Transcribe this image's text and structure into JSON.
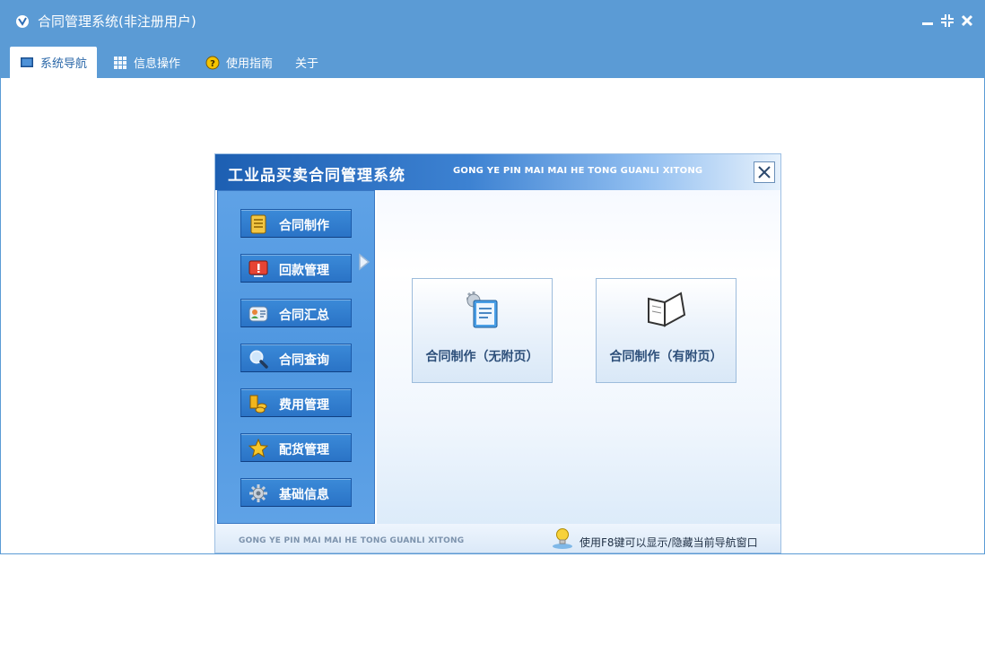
{
  "window": {
    "title": "合同管理系统(非注册用户)"
  },
  "tabs": [
    {
      "label": "系统导航",
      "icon": "monitor-icon",
      "active": true
    },
    {
      "label": "信息操作",
      "icon": "grid-icon",
      "active": false
    },
    {
      "label": "使用指南",
      "icon": "help-icon",
      "active": false
    },
    {
      "label": "关于",
      "icon": "",
      "active": false
    }
  ],
  "panel": {
    "title": "工业品买卖合同管理系统",
    "subtitle": "GONG YE PIN MAI MAI HE TONG GUANLI XITONG",
    "nav": [
      {
        "label": "合同制作",
        "icon": "ledger-icon",
        "selected": true
      },
      {
        "label": "回款管理",
        "icon": "alert-monitor-icon"
      },
      {
        "label": "合同汇总",
        "icon": "contacts-icon"
      },
      {
        "label": "合同查询",
        "icon": "magnifier-icon"
      },
      {
        "label": "费用管理",
        "icon": "coins-icon"
      },
      {
        "label": "配货管理",
        "icon": "star-icon"
      },
      {
        "label": "基础信息",
        "icon": "gear-icon"
      }
    ],
    "tiles": [
      {
        "label": "合同制作（无附页）",
        "icon": "document-gear-icon"
      },
      {
        "label": "合同制作（有附页）",
        "icon": "open-book-icon"
      }
    ],
    "footer_left": "GONG YE PIN MAI MAI HE TONG GUANLI XITONG",
    "footer_hint": "使用F8键可以显示/隐藏当前导航窗口"
  },
  "colors": {
    "titlebar": "#5b9bd5",
    "header_start": "#1d5fb2",
    "sidebar": "#4f97e0",
    "nav_button": "#2a73c6"
  }
}
